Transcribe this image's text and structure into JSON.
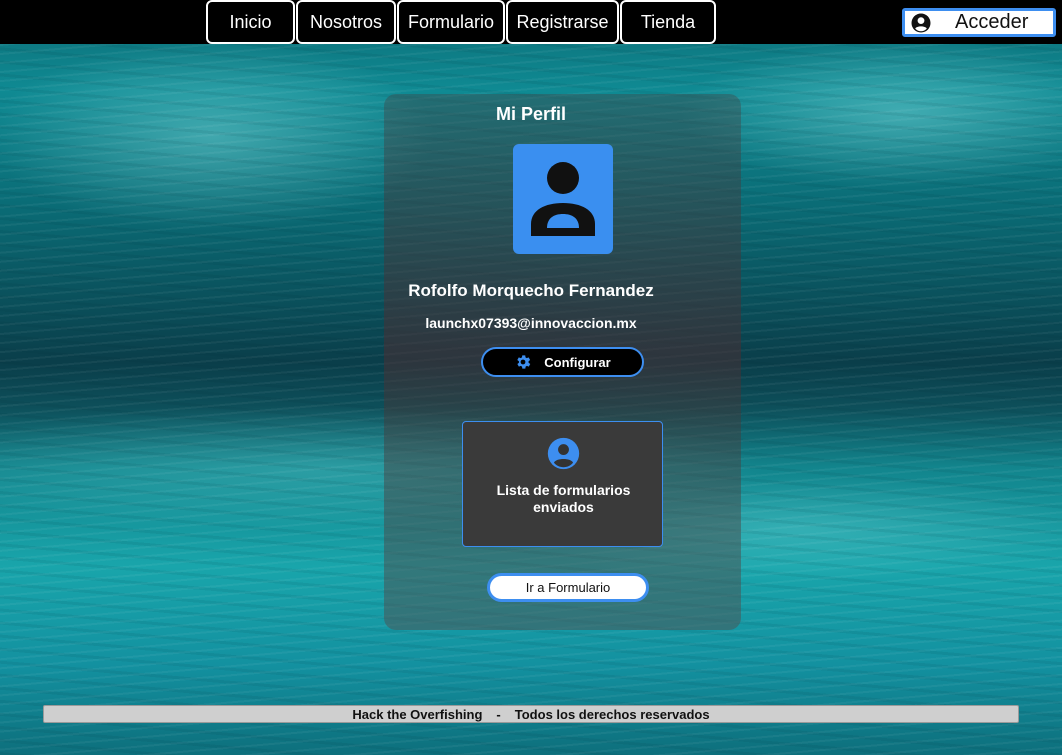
{
  "nav": {
    "items": [
      {
        "label": "Inicio"
      },
      {
        "label": "Nosotros"
      },
      {
        "label": "Formulario"
      },
      {
        "label": "Registrarse"
      },
      {
        "label": "Tienda"
      }
    ],
    "login_label": "Acceder",
    "login_icon": "user-circle-icon"
  },
  "profile": {
    "title": "Mi Perfil",
    "avatar_icon": "user-avatar-icon",
    "name": "Rofolfo Morquecho Fernandez",
    "email": "launchx07393@innovaccion.mx",
    "config_label": "Configurar",
    "config_icon": "gear-icon"
  },
  "forms_card": {
    "icon": "user-circle-icon",
    "label": "Lista de formularios enviados"
  },
  "goto_form_label": "Ir a Formulario",
  "footer": {
    "left": "Hack the Overfishing",
    "separator": "-",
    "right": "Todos los derechos reservados"
  },
  "colors": {
    "accent": "#3d8ef0",
    "topbar": "#000000",
    "footer": "#cfcfcf"
  }
}
